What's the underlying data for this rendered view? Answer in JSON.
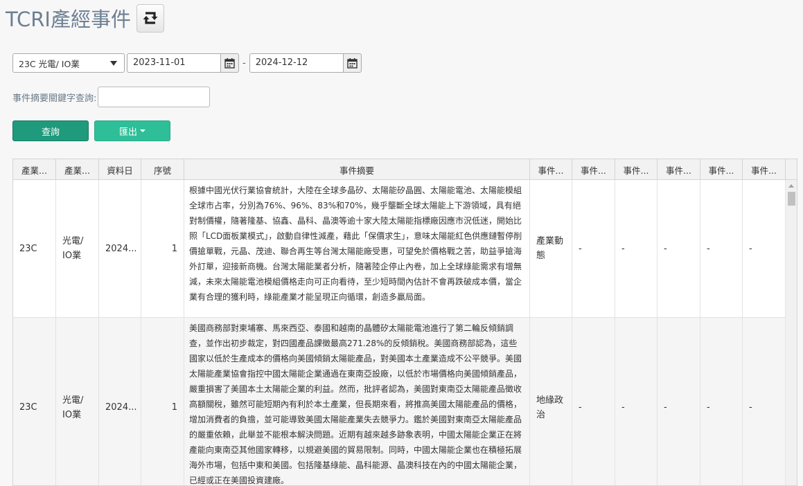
{
  "header": {
    "title": "TCRI產經事件",
    "refresh_icon": "refresh-icon"
  },
  "filters": {
    "industry_selected": "23C 光電/ IO業",
    "date_from": "2023-11-01",
    "date_to": "2024-12-12",
    "range_separator": "-",
    "keyword_label": "事件摘要關鍵字查詢:",
    "keyword_value": ""
  },
  "buttons": {
    "query_label": "查詢",
    "export_label": "匯出"
  },
  "table": {
    "columns": [
      "產業...",
      "產業...",
      "資料日",
      "序號",
      "事件摘要",
      "事件...",
      "事件...",
      "事件...",
      "事件...",
      "事件...",
      "事件..."
    ],
    "rows": [
      {
        "code": "23C",
        "industry": "光電/\nIO業",
        "date": "2024...",
        "seq": "1",
        "summary": "根據中國光伏行業協會統計，大陸在全球多晶矽、太陽能矽晶圓、太陽能電池、太陽能模組全球市占率，分別為76%、96%、83%和70%，幾乎壟斷全球太陽能上下游領域，具有絕對制價權，隨著隆基、協鑫、晶科、晶澳等逾十家大陸太陽能指標廠因應市況低迷，開始比照「LCD面板業模式」，啟動自律性減產，藉此「保價求生」，意味太陽能紅色供應鏈暫停削價搶單戰，元晶、茂迪、聯合再生等台灣太陽能廠受惠，可望免於價格戰之苦，助益爭搶海外訂單，迎接新商機。台灣太陽能業者分析，隨著陸企停止內卷，加上全球綠能需求有增無減，未來太陽能電池模組價格走向可正向看待，至少短時間內估計不會再跌破成本價，當企業有合理的獲利時，綠能產業才能呈現正向循環，創造多贏局面。",
        "event_type": "產業動\n態",
        "e2": "-",
        "e3": "-",
        "e4": "-",
        "e5": "-",
        "e6": "-"
      },
      {
        "code": "23C",
        "industry": "光電/\nIO業",
        "date": "2024...",
        "seq": "1",
        "summary": "美國商務部對柬埔寨、馬來西亞、泰國和越南的晶體矽太陽能電池進行了第二輪反傾銷調查，並作出初步裁定，對四國產品課徵最高271.28%的反傾銷稅。美國商務部認為，這些國家以低於生產成本的價格向美國傾銷太陽能產品，對美國本土產業造成不公平競爭。美國太陽能產業協會指控中國太陽能企業通過在東南亞設廠，以低於市場價格向美國傾銷產品，嚴重損害了美國本土太陽能企業的利益。然而，批評者認為，美國對東南亞太陽能產品徵收高額關稅，雖然可能短期內有利於本土產業，但長期來看，將推高美國太陽能產品的價格，增加消費者的負擔，並可能導致美國太陽能產業失去競爭力。鑑於美國對東南亞太陽能產品的嚴重依賴，此舉並不能根本解決問題。近期有越來越多跡象表明，中國太陽能企業正在將產能向東南亞其他國家轉移，以規避美國的貿易限制。同時，中國太陽能企業也在積極拓展海外市場，包括中東和美國。包括隆基綠能、晶科能源、晶澳科技在內的中國太陽能企業，已經或正在美國投資建廠。",
        "event_type": "地緣政\n治",
        "e2": "-",
        "e3": "-",
        "e4": "-",
        "e5": "-",
        "e6": "-"
      }
    ]
  }
}
